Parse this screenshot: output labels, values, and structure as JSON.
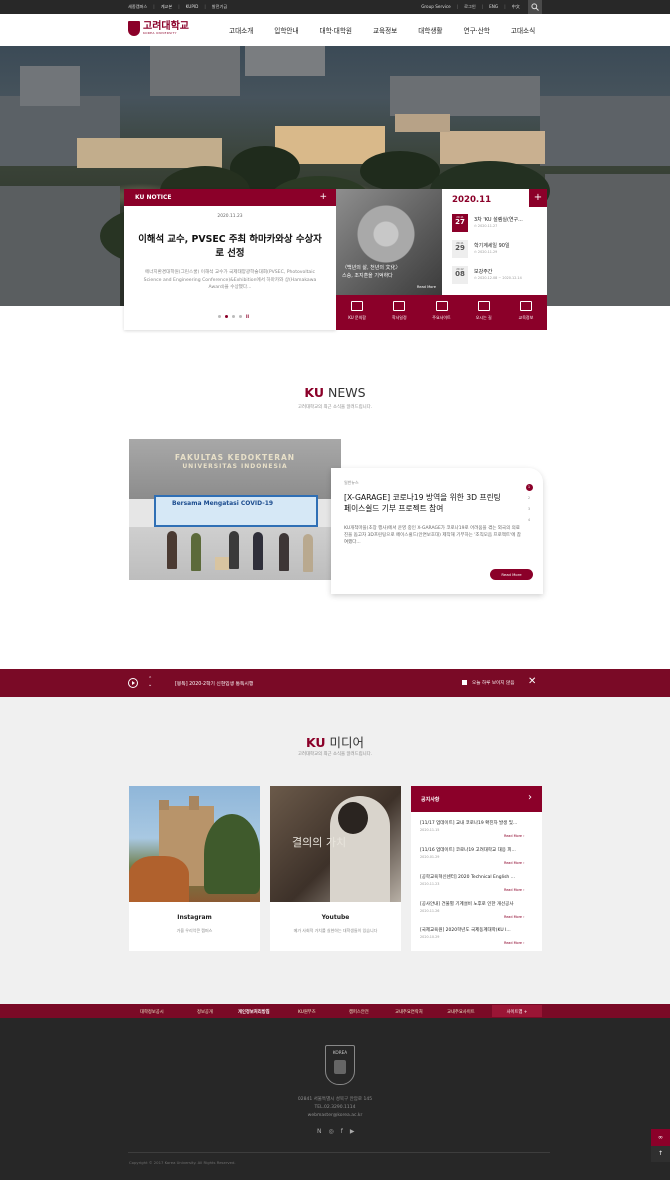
{
  "utility": {
    "left": [
      "세종캠퍼스",
      "계교본",
      "KUPID",
      "발전기금"
    ],
    "right": [
      "Group Service",
      "로그인",
      "ENG",
      "中文"
    ]
  },
  "logo": {
    "ko": "고려대학교",
    "en": "KOREA UNIVERSITY"
  },
  "gnb": [
    "고대소개",
    "입학안내",
    "대학·대학원",
    "교육정보",
    "대학생활",
    "연구·산학",
    "고대소식"
  ],
  "notice": {
    "header": "KU NOTICE",
    "plus": "+",
    "date": "2020.11.23",
    "title": "이해석 교수, PVSEC 주최 하마카와상 수상자로 선정",
    "body": "에너지환경대학원(그린스쿨) 이해석 교수가 국제태양광학술대회(PVSEC, Photovoltaic Science and Engineering Conference)&Exhibition에서 하마카와 상(Hamakawa Award)을 수상했다...",
    "pager_end": "II"
  },
  "feature": {
    "caption_1": "〈백년의 삶, 천년의 文化〉",
    "caption_2": "스승, 조지훈을 기억하다",
    "more": "Read More"
  },
  "calendar": {
    "month": "2020.11",
    "plus": "+",
    "events": [
      {
        "m": "20.11",
        "d": "27",
        "title": "3차 'KU 설렘실(연구...",
        "range": "⊙ 2020.11.27",
        "style": "dark"
      },
      {
        "m": "20.11",
        "d": "29",
        "title": "학기계세일 90일",
        "range": "⊙ 2020.11.29",
        "style": "light"
      },
      {
        "m": "20.12",
        "d": "08",
        "title": "보강주간",
        "range": "⊙ 2020.12.08 ~ 2020.12.14",
        "style": "light"
      }
    ]
  },
  "quick": [
    "KU 문의함",
    "학사일정",
    "주요사이트",
    "오시는 길",
    "교육정보"
  ],
  "news": {
    "title_accent": "KU",
    "title_rest": " NEWS",
    "subtitle": "고려대학교의 최근 소식을 알려드립니다.",
    "img_text_1": "FAKULTAS KEDOKTERAN",
    "img_text_2": "UNIVERSITAS INDONESIA",
    "img_banner": "Bersama Mengatasi COVID-19",
    "category": "일반뉴스",
    "title": "[X-GARAGE] 코로나19 방역을 위한 3D 프린팅 페이스쉴드 기부 프로젝트 참여",
    "body": "KU개척마을(초장 행사)에서 운영 중인 X-GARAGE가 코로나19로 어려움을 겪는 외국의 의료진을 돕고자 3D프린팅으로 페이스쉴드(안면보호대) 제작해 기부하는 '조직모음 프로젝트'에 참여했다...",
    "read_more": "Read More",
    "pages": [
      "1",
      "2",
      "3",
      "4"
    ]
  },
  "alert": {
    "arrow_up": "⌃",
    "arrow_down": "⌄",
    "message": "[봉독] 2020-2학기 신현입생 통독시행",
    "checkbox_label": "오늘 하루 보이지 않음",
    "close": "✕"
  },
  "media": {
    "title_accent": "KU",
    "title_rest": " 미디어",
    "subtitle": "고려대학교의 최근 소식을 알려드립니다.",
    "cards": [
      {
        "label": "Instagram",
        "sub": "가을 우리악콘 캠퍼스"
      },
      {
        "label": "Youtube",
        "sub": "메가 사회적 가치를 실현하는 대학생들이 있습니다"
      }
    ],
    "img2_text": "결의의 가치"
  },
  "notices_card": {
    "header": "공지사항",
    "arrow": "›",
    "items": [
      {
        "title": "[11/17 업데이트] 교내 코로나19 확진자 발생 및...",
        "date": "2020.11.15",
        "more": "Read More ›"
      },
      {
        "title": "[11/16 업데이트] 코로나19 고려대학교 대응 피...",
        "date": "2020.01.29",
        "more": "Read More ›"
      },
      {
        "title": "[공학교육혁신센터] 2020 Technical English ...",
        "date": "2020.11.23",
        "more": "Read More ›"
      },
      {
        "title": "[공사안내] 건물별 기계설비 노후로 인한 개선공사",
        "date": "2020.11.26",
        "more": "Read More ›"
      },
      {
        "title": "[국제교육원] 2020학년도 국제동계대학(KU I...",
        "date": "2020.10.29",
        "more": "Read More ›"
      }
    ]
  },
  "footer_links": [
    "대학정보공시",
    "정보공개",
    "개인정보처리방침",
    "KU원무즈",
    "캠퍼스안전",
    "교내주요연락처",
    "교내주요사이트",
    "사이트맵 +"
  ],
  "footer": {
    "logo_text": "KOREA",
    "address": "02841 서울특별시 성북구 안암로 145",
    "tel": "TEL.02.3290.1114",
    "email": "webmaster@korea.ac.kr",
    "social": [
      "N",
      "◎",
      "f",
      "▶"
    ],
    "copyright": "Copyright © 2017 Korea University. All Rights Reserved."
  },
  "side_button": "∞",
  "top_button": "↑",
  "colors": {
    "brand": "#8b0029",
    "footer": "#272727",
    "media_bg": "#f0f0f0"
  }
}
